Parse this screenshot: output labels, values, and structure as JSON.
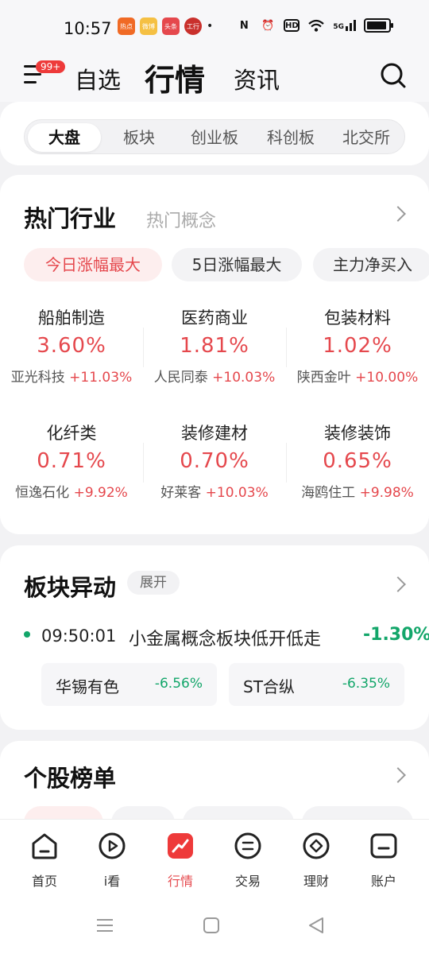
{
  "status": {
    "time": "10:57",
    "app_badges": [
      "热点",
      "微博",
      "头条",
      "工行"
    ],
    "net": "5G"
  },
  "header": {
    "badge": "99+",
    "tabs": [
      "自选",
      "行情",
      "资讯"
    ],
    "active_tab": "行情"
  },
  "market_tabs": [
    "大盘",
    "板块",
    "创业板",
    "科创板",
    "北交所"
  ],
  "hot": {
    "title": "热门行业",
    "subtitle": "热门概念",
    "pills": [
      "今日涨幅最大",
      "5日涨幅最大",
      "主力净买入"
    ],
    "items": [
      {
        "name": "船舶制造",
        "pct": "3.60%",
        "stock": "亚光科技",
        "stock_pct": "+11.03%"
      },
      {
        "name": "医药商业",
        "pct": "1.81%",
        "stock": "人民同泰",
        "stock_pct": "+10.03%"
      },
      {
        "name": "包装材料",
        "pct": "1.02%",
        "stock": "陕西金叶",
        "stock_pct": "+10.00%"
      },
      {
        "name": "化纤类",
        "pct": "0.71%",
        "stock": "恒逸石化",
        "stock_pct": "+9.92%"
      },
      {
        "name": "装修建材",
        "pct": "0.70%",
        "stock": "好莱客",
        "stock_pct": "+10.03%"
      },
      {
        "name": "装修装饰",
        "pct": "0.65%",
        "stock": "海鸥住工",
        "stock_pct": "+9.98%"
      }
    ]
  },
  "movement": {
    "title": "板块异动",
    "expand": "展开",
    "time": "09:50:01",
    "text": "小金属概念板块低开低走",
    "pct": "-1.30%",
    "stocks": [
      {
        "name": "华锡有色",
        "pct": "-6.56%"
      },
      {
        "name": "ST合纵",
        "pct": "-6.35%"
      }
    ]
  },
  "rank": {
    "title": "个股榜单"
  },
  "nav": [
    {
      "label": "首页",
      "icon": "home-icon"
    },
    {
      "label": "i看",
      "icon": "play-icon"
    },
    {
      "label": "行情",
      "icon": "trend-icon"
    },
    {
      "label": "交易",
      "icon": "exchange-icon"
    },
    {
      "label": "理财",
      "icon": "diamond-icon"
    },
    {
      "label": "账户",
      "icon": "account-icon"
    }
  ],
  "colors": {
    "up": "#e5484d",
    "down": "#13a66a",
    "accent": "#ee3a3a"
  }
}
